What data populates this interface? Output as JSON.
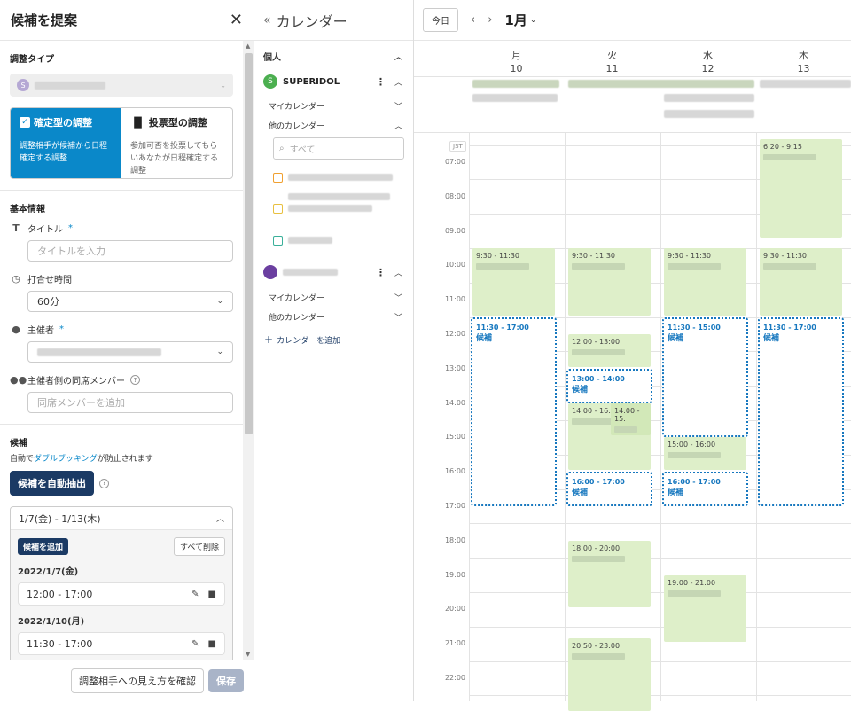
{
  "left": {
    "title": "候補を提案",
    "adjust_type_label": "調整タイプ",
    "account_avatar": "S",
    "types": [
      {
        "title": "確定型の調整",
        "desc": "調整相手が候補から日程確定する調整"
      },
      {
        "title": "投票型の調整",
        "desc": "参加可否を投票してもらいあなたが日程確定する調整"
      }
    ],
    "basic_info": "基本情報",
    "title_label": "タイトル",
    "title_required": "*",
    "title_placeholder": "タイトルを入力",
    "duration_label": "打合せ時間",
    "duration_value": "60分",
    "organizer_label": "主催者",
    "organizer_required": "*",
    "attendees_label": "主催者側の同席メンバー",
    "attendees_placeholder": "同席メンバーを追加",
    "candidates_label": "候補",
    "auto_text_prefix": "自動で",
    "auto_text_link": "ダブルブッキング",
    "auto_text_suffix": "が防止されます",
    "auto_extract_button": "候補を自動抽出",
    "range_label": "1/7(金) - 1/13(木)",
    "add_candidate_button": "候補を追加",
    "delete_all_button": "すべて削除",
    "dates": [
      {
        "date": "2022/1/7(金)",
        "slot": "12:00 - 17:00"
      },
      {
        "date": "2022/1/10(月)",
        "slot": "11:30 - 17:00"
      }
    ],
    "preview_button": "調整相手への見え方を確認",
    "save_button": "保存"
  },
  "middle": {
    "title": "カレンダー",
    "personal": "個人",
    "account1": {
      "avatar": "S",
      "name": "SUPERIDOL",
      "my_calendar": "マイカレンダー",
      "other_calendar": "他のカレンダー"
    },
    "search_placeholder": "すべて",
    "account2": {
      "my_calendar": "マイカレンダー",
      "other_calendar": "他のカレンダー"
    },
    "add_calendar": "カレンダーを追加"
  },
  "calendar": {
    "today": "今日",
    "month": "1月",
    "timezone": "JST",
    "days": [
      {
        "dow": "月",
        "num": "10"
      },
      {
        "dow": "火",
        "num": "11"
      },
      {
        "dow": "水",
        "num": "12"
      },
      {
        "dow": "木",
        "num": "13"
      }
    ],
    "hours": [
      "07:00",
      "08:00",
      "09:00",
      "10:00",
      "11:00",
      "12:00",
      "13:00",
      "14:00",
      "15:00",
      "16:00",
      "17:00",
      "18:00",
      "19:00",
      "20:00",
      "21:00",
      "22:00"
    ],
    "events": [
      {
        "day": 3,
        "time": "6:20 - 9:15",
        "start": 6.333,
        "end": 9.25
      },
      {
        "day": 0,
        "time": "9:30 - 11:30",
        "start": 9.5,
        "end": 11.5
      },
      {
        "day": 1,
        "time": "9:30 - 11:30",
        "start": 9.5,
        "end": 11.5
      },
      {
        "day": 2,
        "time": "9:30 - 11:30",
        "start": 9.5,
        "end": 11.5
      },
      {
        "day": 3,
        "time": "9:30 - 11:30",
        "start": 9.5,
        "end": 11.5
      },
      {
        "day": 1,
        "time": "12:00 - 13:00",
        "start": 12,
        "end": 13
      },
      {
        "day": 1,
        "time": "14:00 - 16:00",
        "start": 14,
        "end": 16
      },
      {
        "day": 1,
        "time": "14:00 - 15:",
        "start": 14,
        "end": 15,
        "half": true
      },
      {
        "day": 2,
        "time": "15:00 - 16:00",
        "start": 15,
        "end": 16
      },
      {
        "day": 1,
        "time": "18:00 - 20:00",
        "start": 18,
        "end": 20
      },
      {
        "day": 2,
        "time": "19:00 - 21:00",
        "start": 19,
        "end": 21
      },
      {
        "day": 1,
        "time": "20:50 - 23:00",
        "start": 20.833,
        "end": 23
      }
    ],
    "candidates": [
      {
        "day": 0,
        "time": "11:30 - 17:00",
        "label": "候補",
        "start": 11.5,
        "end": 17
      },
      {
        "day": 1,
        "time": "13:00 - 14:00",
        "label": "候補",
        "start": 13,
        "end": 14
      },
      {
        "day": 1,
        "time": "16:00 - 17:00",
        "label": "候補",
        "start": 16,
        "end": 17
      },
      {
        "day": 2,
        "time": "11:30 - 15:00",
        "label": "候補",
        "start": 11.5,
        "end": 15
      },
      {
        "day": 2,
        "time": "16:00 - 17:00",
        "label": "候補",
        "start": 16,
        "end": 17
      },
      {
        "day": 3,
        "time": "11:30 - 17:00",
        "label": "候補",
        "start": 11.5,
        "end": 17
      }
    ]
  }
}
